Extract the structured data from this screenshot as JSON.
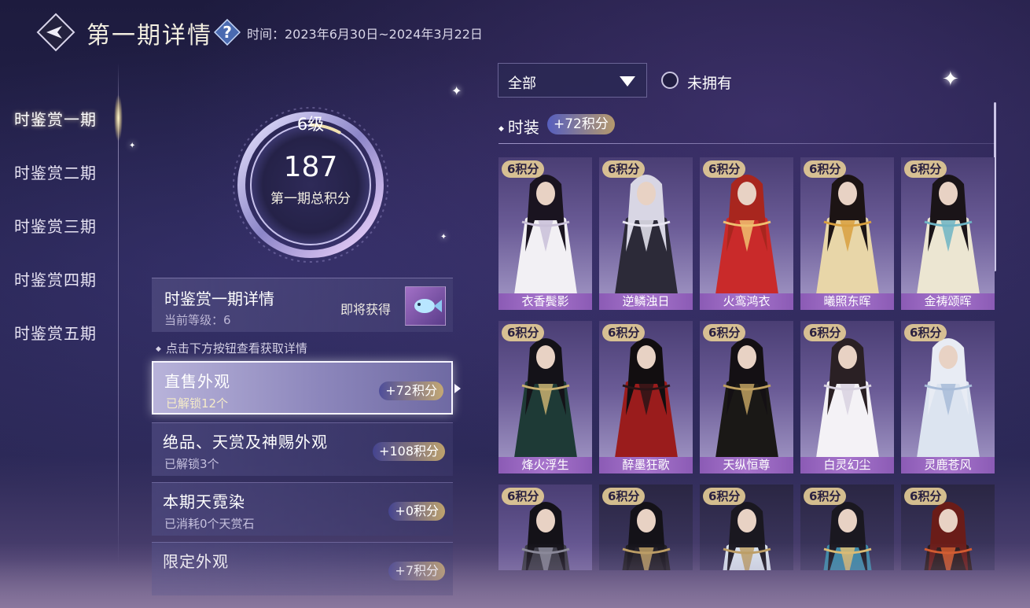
{
  "header": {
    "title": "第一期详情",
    "time_text": "时间：2023年6月30日~2024年3月22日"
  },
  "nav": {
    "items": [
      {
        "label": "时鉴赏一期",
        "active": true
      },
      {
        "label": "时鉴赏二期",
        "active": false
      },
      {
        "label": "时鉴赏三期",
        "active": false
      },
      {
        "label": "时鉴赏四期",
        "active": false
      },
      {
        "label": "时鉴赏五期",
        "active": false
      }
    ]
  },
  "level": {
    "level_text": "6级",
    "score": "187",
    "caption": "第一期总积分",
    "progress_fraction": 0.08
  },
  "detail": {
    "title": "时鉴赏一期详情",
    "current_level": "当前等级：6",
    "soon_label": "即将获得"
  },
  "hint": "点击下方按钮查看获取详情",
  "categories": [
    {
      "title": "直售外观",
      "sub": "已解锁12个",
      "badge": "+72积分",
      "active": true
    },
    {
      "title": "绝品、天赏及神赐外观",
      "sub": "已解锁3个",
      "badge": "+108积分",
      "active": false
    },
    {
      "title": "本期天霓染",
      "sub": "已消耗0个天赏石",
      "badge": "+0积分",
      "active": false
    },
    {
      "title": "限定外观",
      "sub": "",
      "badge": "+7积分",
      "active": false
    }
  ],
  "filter": {
    "dropdown_value": "全部",
    "radio_label": "未拥有"
  },
  "section": {
    "title": "时装",
    "badge": "+72积分"
  },
  "outfits": [
    {
      "points": "6积分",
      "name": "衣香鬓影",
      "hair": "#1a1420",
      "robe": "#f2f0f4",
      "accent": "#c9c0d8",
      "dark": false
    },
    {
      "points": "6积分",
      "name": "逆鳞浊日",
      "hair": "#d8d6e4",
      "robe": "#2c2a38",
      "accent": "#e9e7f2",
      "dark": false
    },
    {
      "points": "6积分",
      "name": "火鸾鸿衣",
      "hair": "#a8261e",
      "robe": "#c92a2a",
      "accent": "#f0c070",
      "dark": false
    },
    {
      "points": "6积分",
      "name": "曦照东晖",
      "hair": "#1c1414",
      "robe": "#e8d6a8",
      "accent": "#d8a040",
      "dark": false
    },
    {
      "points": "6积分",
      "name": "金祷颂晖",
      "hair": "#1a1418",
      "robe": "#ece6d2",
      "accent": "#6fb4c4",
      "dark": false
    },
    {
      "points": "6积分",
      "name": "烽火浮生",
      "hair": "#141218",
      "robe": "#1e3a36",
      "accent": "#c9b070",
      "dark": false
    },
    {
      "points": "6积分",
      "name": "醉墨狂歌",
      "hair": "#120e10",
      "robe": "#9a1c1c",
      "accent": "#2a1416",
      "dark": false
    },
    {
      "points": "6积分",
      "name": "天纵恒尊",
      "hair": "#141014",
      "robe": "#1a1816",
      "accent": "#c0a060",
      "dark": false
    },
    {
      "points": "6积分",
      "name": "白灵幻尘",
      "hair": "#2a2024",
      "robe": "#f4f2f6",
      "accent": "#d8d2e0",
      "dark": false
    },
    {
      "points": "6积分",
      "name": "灵鹿苍风",
      "hair": "#e8ecf4",
      "robe": "#dce4f0",
      "accent": "#a8bcd8",
      "dark": false
    },
    {
      "points": "6积分",
      "name": "",
      "hair": "#141218",
      "robe": "#3a3a44",
      "accent": "#8a8a98",
      "dark": false
    },
    {
      "points": "6积分",
      "name": "",
      "hair": "#141218",
      "robe": "#1e1c22",
      "accent": "#c0a060",
      "dark": true
    },
    {
      "points": "6积分",
      "name": "",
      "hair": "#1a1820",
      "robe": "#dce6f0",
      "accent": "#c0a060",
      "dark": true
    },
    {
      "points": "6积分",
      "name": "",
      "hair": "#1a1820",
      "robe": "#3a8aa8",
      "accent": "#e0c070",
      "dark": true
    },
    {
      "points": "6积分",
      "name": "",
      "hair": "#6a1c18",
      "robe": "#2a1a1a",
      "accent": "#d85a28",
      "dark": true
    }
  ],
  "colors": {
    "accent_gold": "#e6cd96",
    "card_purple": "#a774cc",
    "background": "#262450"
  },
  "icons": {
    "back": "back-arrow-icon",
    "help": "question-mark-icon",
    "dropdown": "caret-down-icon",
    "detail_thumb": "fish-item-icon"
  }
}
